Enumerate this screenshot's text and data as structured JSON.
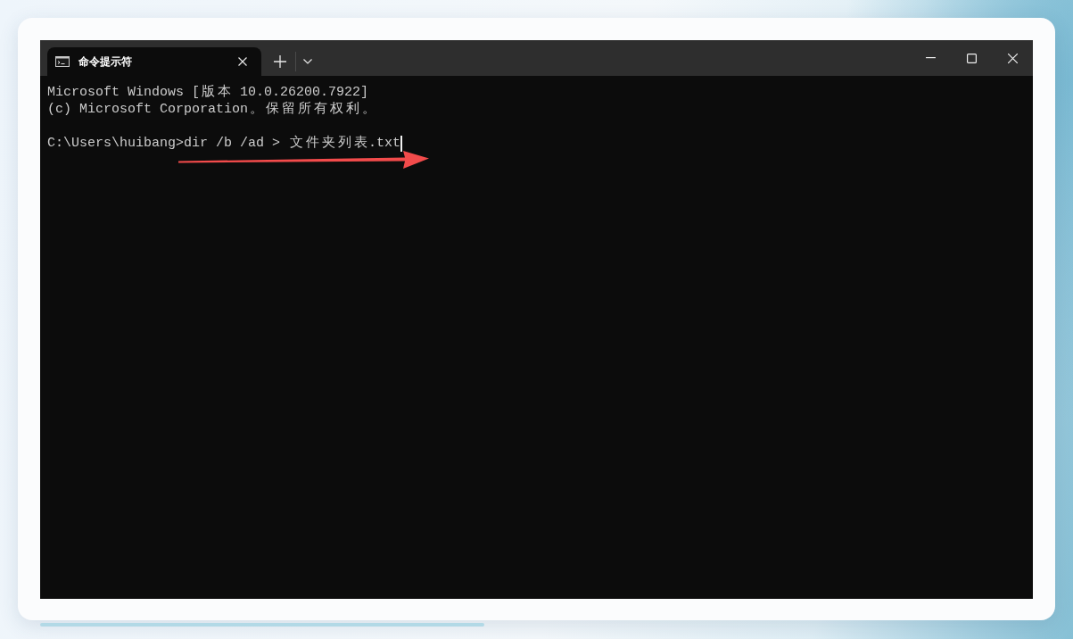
{
  "tabs": [
    {
      "title": "命令提示符",
      "selected": true
    }
  ],
  "console": {
    "lines": [
      {
        "text": "Microsoft Windows [版本 10.0.26200.7922]"
      },
      {
        "text": "(c) Microsoft Corporation。保留所有权利。"
      }
    ],
    "prompt_line": {
      "text": "C:\\Users\\huibang>dir /b /ad > 文件夹列表.txt",
      "cursor": true
    }
  },
  "annotations": [
    {
      "kind": "arrow"
    }
  ]
}
